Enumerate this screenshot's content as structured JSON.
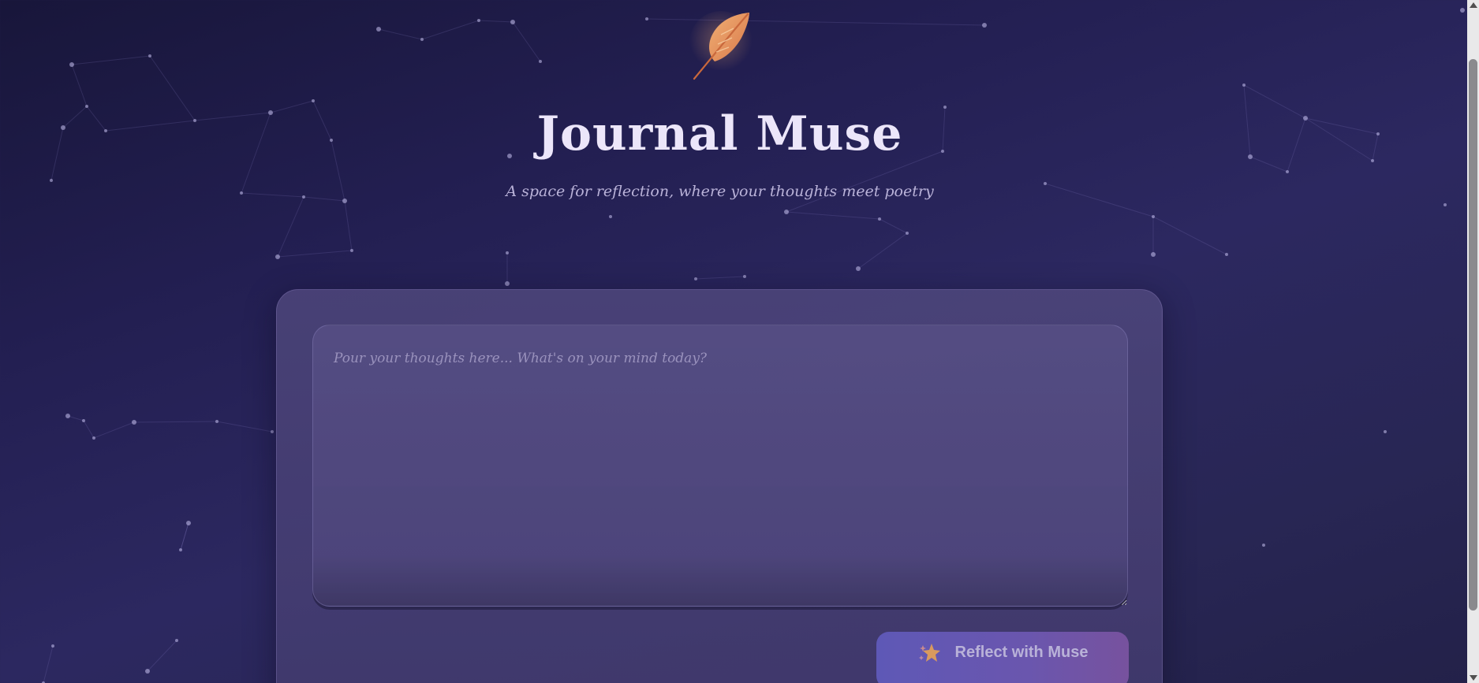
{
  "header": {
    "logo_icon": "feather-quill-icon",
    "title": "Journal Muse",
    "subtitle": "A space for reflection, where your thoughts meet poetry"
  },
  "entry": {
    "placeholder": "Pour your thoughts here... What's on your mind today?",
    "value": ""
  },
  "actions": {
    "reflect_icon": "sparkle-stars-icon",
    "reflect_label": "Reflect with Muse"
  },
  "colors": {
    "background_dark": "#18163a",
    "background_mid": "#2c2860",
    "card": "#4a4478",
    "accent_button_start": "#5e58b6",
    "accent_button_end": "#77529e",
    "title_text": "#ece6fa",
    "feather": "#e7995e"
  }
}
